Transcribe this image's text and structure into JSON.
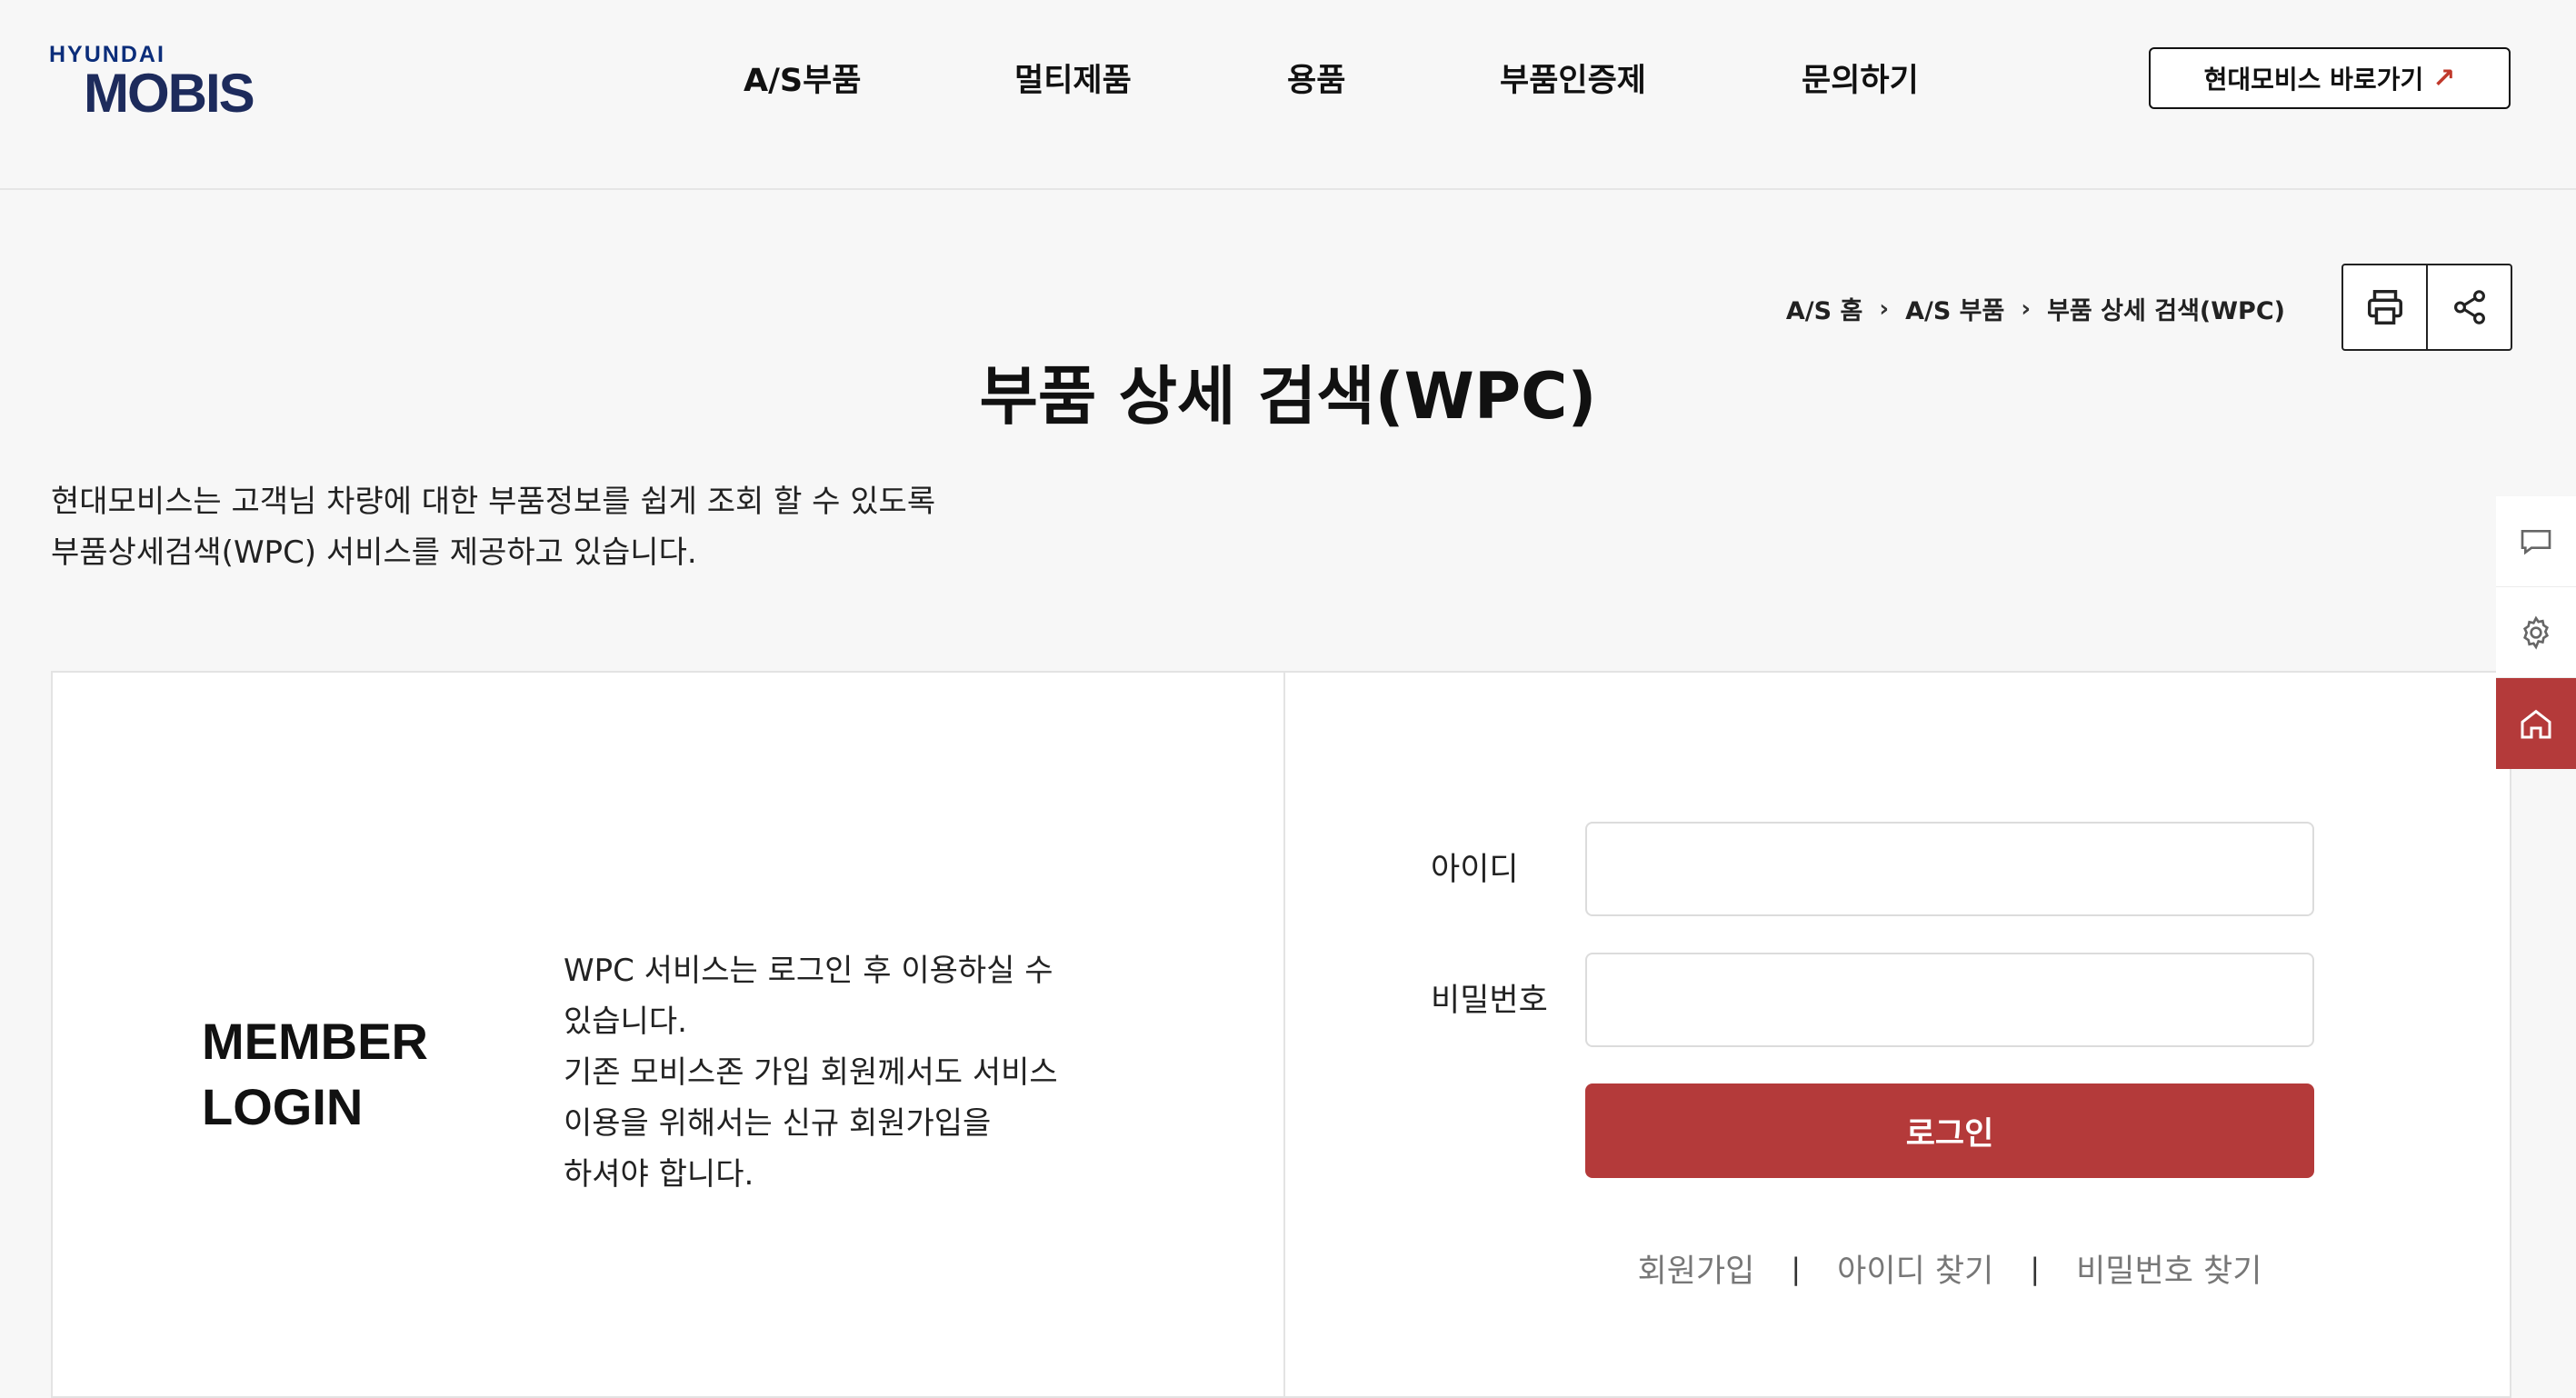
{
  "logo": {
    "top": "HYUNDAI",
    "bottom": "MOBIS"
  },
  "nav": {
    "items": [
      {
        "label": "A/S부품"
      },
      {
        "label": "멀티제품"
      },
      {
        "label": "용품"
      },
      {
        "label": "부품인증제"
      },
      {
        "label": "문의하기"
      }
    ],
    "external_button": {
      "label": "현대모비스 바로가기",
      "icon": "external-arrow-icon"
    }
  },
  "breadcrumb": [
    "A/S 홈",
    "A/S 부품",
    "부품 상세 검색(WPC)"
  ],
  "tools": {
    "print_icon": "printer-icon",
    "share_icon": "share-icon"
  },
  "page": {
    "title": "부품 상세 검색(WPC)",
    "intro_lines": [
      "현대모비스는 고객님 차량에 대한 부품정보를 쉽게 조회 할 수 있도록",
      "부품상세검색(WPC) 서비스를 제공하고 있습니다."
    ]
  },
  "login": {
    "heading_lines": [
      "MEMBER",
      "LOGIN"
    ],
    "description_lines": [
      "WPC 서비스는 로그인 후 이용하실 수",
      "있습니다.",
      "기존 모비스존 가입 회원께서도 서비스",
      "이용을 위해서는 신규 회원가입을",
      "하셔야 합니다."
    ],
    "id_label": "아이디",
    "id_value": "",
    "password_label": "비밀번호",
    "password_value": "",
    "submit_label": "로그인",
    "links": [
      "회원가입",
      "아이디 찾기",
      "비밀번호 찾기"
    ],
    "link_separator": "|"
  },
  "sidebar": {
    "items": [
      {
        "icon": "chat-icon"
      },
      {
        "icon": "gear-icon"
      },
      {
        "icon": "home-icon",
        "active": true
      }
    ]
  },
  "colors": {
    "accent": "#b43a3a",
    "background": "#f7f7f7",
    "text": "#111111"
  }
}
